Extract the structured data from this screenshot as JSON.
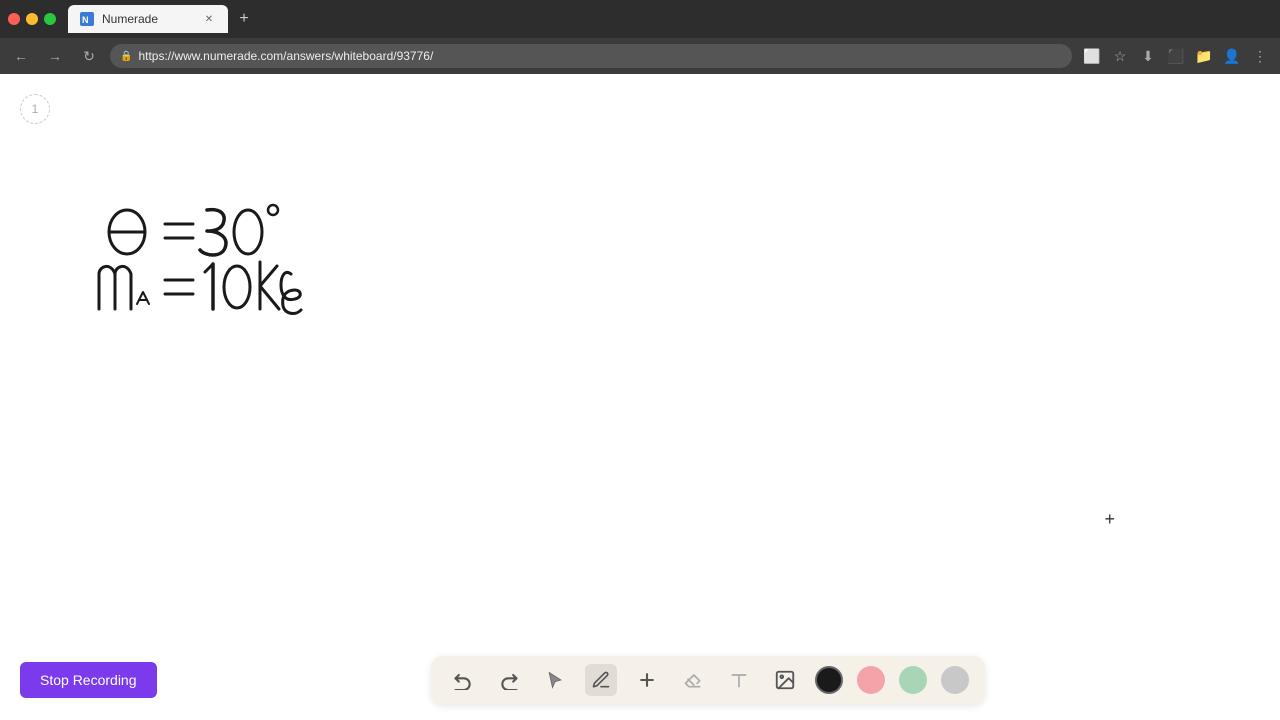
{
  "browser": {
    "tab_title": "Numerade",
    "tab_url": "https://www.numerade.com/answers/whiteboard/93776/",
    "new_tab_label": "+"
  },
  "toolbar": {
    "undo_label": "↺",
    "redo_label": "↻",
    "select_label": "▶",
    "pen_label": "✏",
    "add_label": "+",
    "eraser_label": "✂",
    "text_label": "A",
    "image_label": "🖼",
    "colors": [
      "#1a1a1a",
      "#f4a4a8",
      "#a8d5b5",
      "#c8c8c8"
    ],
    "color_names": [
      "black",
      "pink",
      "green",
      "gray"
    ]
  },
  "page": {
    "number": "1",
    "stop_recording": "Stop Recording"
  },
  "math": {
    "line1": "θ = 30°",
    "line2": "m_A = 10 kg"
  }
}
